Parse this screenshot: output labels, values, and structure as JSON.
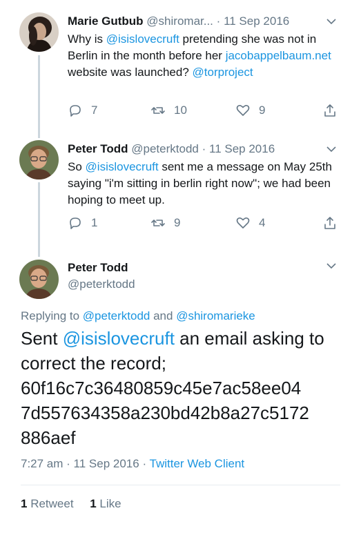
{
  "tweets": [
    {
      "name": "Marie Gutbub",
      "handle": "@shiromar...",
      "sep": "·",
      "date": "11 Sep 2016",
      "body": [
        {
          "text": "Why is ",
          "link": false
        },
        {
          "text": "@isislovecruft",
          "link": true
        },
        {
          "text": " pretending she was not in Berlin in the month before her ",
          "link": false
        },
        {
          "text": "jacobappelbaum.net",
          "link": true
        },
        {
          "text": " website was launched? ",
          "link": false
        },
        {
          "text": "@torproject",
          "link": true
        }
      ],
      "replies": "7",
      "retweets": "10",
      "likes": "9"
    },
    {
      "name": "Peter Todd",
      "handle": "@peterktodd",
      "sep": "·",
      "date": "11 Sep 2016",
      "body": [
        {
          "text": "So ",
          "link": false
        },
        {
          "text": "@isislovecruft",
          "link": true
        },
        {
          "text": " sent me a message on May 25th saying \"i'm sitting in berlin right now\"; we had been hoping to meet up.",
          "link": false
        }
      ],
      "replies": "1",
      "retweets": "9",
      "likes": "4"
    }
  ],
  "main": {
    "name": "Peter Todd",
    "handle": "@peterktodd",
    "replying_prefix": "Replying to ",
    "replying_user1": "@peterktodd",
    "replying_and": " and ",
    "replying_user2": "@shiromarieke",
    "text_prefix": "Sent ",
    "text_mention": "@isislovecruft",
    "text_line1_rest": " an email asking to",
    "text_line2": "correct the record;",
    "text_line3": "60f16c7c36480859c45e7ac58ee04",
    "text_line4": "7d557634358a230bd42b8a27c5172",
    "text_line5": "886aef",
    "time": "7:27 am",
    "meta_sep": " · ",
    "date": "11 Sep 2016",
    "client": "Twitter Web Client",
    "retweet_count": "1",
    "retweet_label": " Retweet",
    "like_count": "1",
    "like_label": " Like"
  },
  "colors": {
    "link": "#1b95e0",
    "secondary": "#657786",
    "primary": "#14171a",
    "thread_line": "#ccd6dd"
  },
  "icons": [
    "reply-icon",
    "retweet-icon",
    "like-icon",
    "share-icon",
    "chevron-down-icon",
    "avatar"
  ]
}
